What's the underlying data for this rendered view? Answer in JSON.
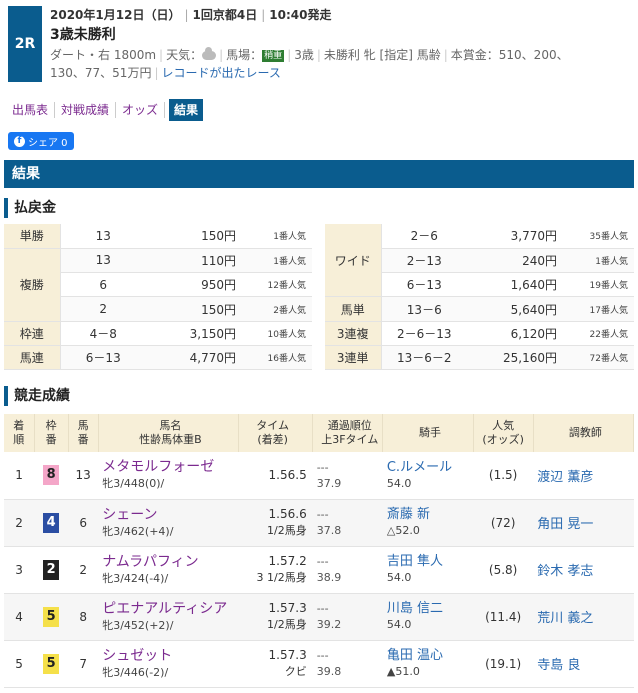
{
  "race": {
    "number": "2R",
    "date": "2020年1月12日（日）",
    "meeting": "1回京都4日",
    "start": "10:40発走",
    "name": "3歳未勝利",
    "course": "ダート・右 1800m",
    "weather_label": "天気：",
    "track_label": "馬場：",
    "track_badge": "稍重",
    "class_text": "3歳",
    "conditions": "未勝利 牝 [指定] 馬齢",
    "prize_line1": "本賞金：510、200、",
    "prize_line2": "130、77、51万円",
    "record_link": "レコードが出たレース"
  },
  "tabs": [
    "出馬表",
    "対戦成績",
    "オッズ",
    "結果"
  ],
  "share_label": "シェア 0",
  "section_title": "結果",
  "payout_title": "払戻金",
  "results_title": "競走成績",
  "payout_left": [
    {
      "kind": "単勝",
      "nums": "13",
      "yen": "150円",
      "pop": "1番人気"
    },
    {
      "kind": "複勝",
      "nums": "13",
      "yen": "110円",
      "pop": "1番人気"
    },
    {
      "kind": "",
      "nums": "6",
      "yen": "950円",
      "pop": "12番人気"
    },
    {
      "kind": "",
      "nums": "2",
      "yen": "150円",
      "pop": "2番人気"
    },
    {
      "kind": "枠連",
      "nums": "4－8",
      "yen": "3,150円",
      "pop": "10番人気"
    },
    {
      "kind": "馬連",
      "nums": "6－13",
      "yen": "4,770円",
      "pop": "16番人気"
    }
  ],
  "payout_right": [
    {
      "kind": "ワイド",
      "nums": "2－6",
      "yen": "3,770円",
      "pop": "35番人気"
    },
    {
      "kind": "",
      "nums": "2－13",
      "yen": "240円",
      "pop": "1番人気"
    },
    {
      "kind": "",
      "nums": "6－13",
      "yen": "1,640円",
      "pop": "19番人気"
    },
    {
      "kind": "馬単",
      "nums": "13－6",
      "yen": "5,640円",
      "pop": "17番人気"
    },
    {
      "kind": "3連複",
      "nums": "2－6－13",
      "yen": "6,120円",
      "pop": "22番人気"
    },
    {
      "kind": "3連単",
      "nums": "13－6－2",
      "yen": "25,160円",
      "pop": "72番人気"
    }
  ],
  "results_headers": {
    "rank": "着\n順",
    "waku": "枠\n番",
    "num": "馬\n番",
    "horse": "馬名\n性齢馬体重B",
    "time": "タイム\n(着差)",
    "pass": "通過順位\n上3Fタイム",
    "jockey": "騎手",
    "pop": "人気\n(オッズ)",
    "trainer": "調教師"
  },
  "results": [
    {
      "rank": "1",
      "waku": "8",
      "waku_bg": "#f4a6c8",
      "waku_fg": "#222",
      "num": "13",
      "horse": "メタモルフォーゼ",
      "sub": "牝3/448(0)/",
      "time": "1.56.5",
      "diff": "",
      "pass": "---",
      "f3": "37.9",
      "jockey": "C.ルメール",
      "weight": "54.0",
      "odds": "(1.5)",
      "trainer": "渡辺 薫彦"
    },
    {
      "rank": "2",
      "waku": "4",
      "waku_bg": "#2b4ea3",
      "waku_fg": "#fff",
      "num": "6",
      "horse": "シェーン",
      "sub": "牝3/462(+4)/",
      "time": "1.56.6",
      "diff": "1/2馬身",
      "pass": "---",
      "f3": "37.8",
      "jockey": "斎藤 新",
      "weight": "△52.0",
      "odds": "(72)",
      "trainer": "角田 晃一"
    },
    {
      "rank": "3",
      "waku": "2",
      "waku_bg": "#222222",
      "waku_fg": "#fff",
      "num": "2",
      "horse": "ナムラパフィン",
      "sub": "牝3/424(-4)/",
      "time": "1.57.2",
      "diff": "3 1/2馬身",
      "pass": "---",
      "f3": "38.9",
      "jockey": "吉田 隼人",
      "weight": "54.0",
      "odds": "(5.8)",
      "trainer": "鈴木 孝志"
    },
    {
      "rank": "4",
      "waku": "5",
      "waku_bg": "#f5e04a",
      "waku_fg": "#222",
      "num": "8",
      "horse": "ピエナアルティシア",
      "sub": "牝3/452(+2)/",
      "time": "1.57.3",
      "diff": "1/2馬身",
      "pass": "---",
      "f3": "39.2",
      "jockey": "川島 信二",
      "weight": "54.0",
      "odds": "(11.4)",
      "trainer": "荒川 義之"
    },
    {
      "rank": "5",
      "waku": "5",
      "waku_bg": "#f5e04a",
      "waku_fg": "#222",
      "num": "7",
      "horse": "シュゼット",
      "sub": "牝3/446(-2)/",
      "time": "1.57.3",
      "diff": "クビ",
      "pass": "---",
      "f3": "39.8",
      "jockey": "亀田 温心",
      "weight": "▲51.0",
      "odds": "(19.1)",
      "trainer": "寺島 良"
    }
  ],
  "colors": {
    "accent": "#0a5c8e",
    "horse_link": "#7b2a8f",
    "person_link": "#2a6ab0",
    "header_bg": "#f7efd8"
  }
}
